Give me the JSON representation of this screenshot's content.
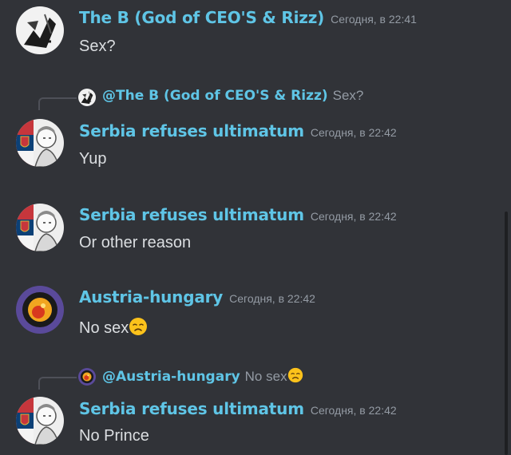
{
  "colors": {
    "background": "#313338",
    "username": "#5fc5e6",
    "timestamp": "#949ba4",
    "message_text": "#dbdee1"
  },
  "messages": [
    {
      "username": "The B (God of CEO'S & Rizz)",
      "timestamp": "Сегодня, в 22:41",
      "content": "Sex?",
      "avatar_icon": "artwork-avatar-icon"
    },
    {
      "reply": {
        "username": "@The B (God of CEO'S & Rizz)",
        "content": "Sex?"
      },
      "username": "Serbia refuses ultimatum",
      "timestamp": "Сегодня, в 22:42",
      "content": "Yup",
      "avatar_icon": "serbia-character-avatar-icon"
    },
    {
      "username": "Serbia refuses ultimatum",
      "timestamp": "Сегодня, в 22:42",
      "content": "Or other reason",
      "avatar_icon": "serbia-character-avatar-icon"
    },
    {
      "username": "Austria-hungary",
      "timestamp": "Сегодня, в 22:42",
      "content": "No sex",
      "emoji": "disappointed-face-emoji",
      "avatar_icon": "orb-avatar-icon"
    },
    {
      "reply": {
        "username": "@Austria-hungary",
        "content": "No sex",
        "emoji": "disappointed-face-emoji"
      },
      "username": "Serbia refuses ultimatum",
      "timestamp": "Сегодня, в 22:42",
      "content": "No Prince",
      "avatar_icon": "serbia-character-avatar-icon"
    }
  ]
}
